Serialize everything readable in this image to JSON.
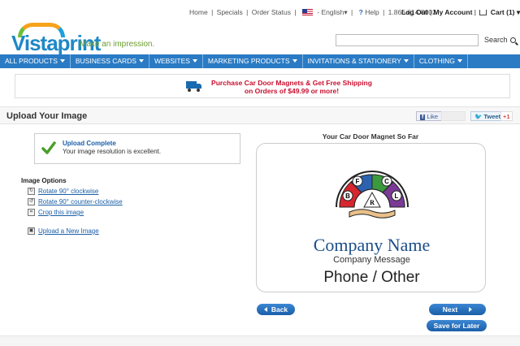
{
  "topbar": {
    "home": "Home",
    "specials": "Specials",
    "order_status": "Order Status",
    "language": "English",
    "help": "Help",
    "phone": "1.866.614.8002",
    "logout": "Log Out",
    "my_account": "My Account",
    "cart": "Cart (1)",
    "sep": "|",
    "caret": "▾",
    "help_glyph": "?"
  },
  "logo": {
    "text": "Vistaprint",
    "tagline": "Make an impression."
  },
  "search": {
    "placeholder": "",
    "button": "Search"
  },
  "nav": {
    "items": [
      "ALL PRODUCTS",
      "BUSINESS CARDS",
      "WEBSITES",
      "MARKETING PRODUCTS",
      "INVITATIONS & STATIONERY",
      "CLOTHING"
    ]
  },
  "promo": {
    "line1": "Purchase Car Door Magnets & Get Free Shipping",
    "line2": "on Orders of $49.99 or more!",
    "icon": "truck-icon"
  },
  "header": {
    "title": "Upload Your Image",
    "like": "Like",
    "tweet": "Tweet",
    "gplus": "+1"
  },
  "upload": {
    "title": "Upload Complete",
    "message": "Your image resolution is excellent."
  },
  "options": {
    "title": "Image Options",
    "rotate_cw": "Rotate 90° clockwise",
    "rotate_ccw": "Rotate 90° counter-clockwise",
    "crop": "Crop this image",
    "upload_new": "Upload a New Image"
  },
  "preview": {
    "title": "Your Car Door Magnet So Far",
    "company_name": "Company Name",
    "company_message": "Company Message",
    "phone": "Phone / Other",
    "emblem_letters": [
      "B",
      "F",
      "C",
      "L",
      "R"
    ]
  },
  "buttons": {
    "back": "Back",
    "next": "Next",
    "save": "Save for Later"
  },
  "colors": {
    "nav": "#2a7bc4",
    "link": "#1a5fa8",
    "promo": "#c8102e",
    "brand": "#1e88c8"
  }
}
